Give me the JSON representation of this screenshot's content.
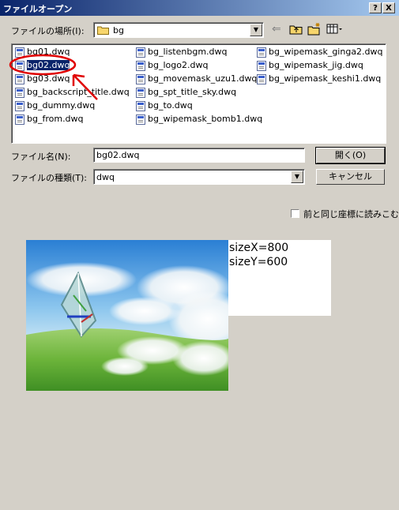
{
  "window": {
    "title": "ファイルオープン",
    "help_label": "?",
    "close_label": "X"
  },
  "location": {
    "label": "ファイルの場所(I):",
    "value": "bg"
  },
  "files": [
    "bg01.dwq",
    "bg02.dwq",
    "bg03.dwq",
    "bg_backscript_title.dwq",
    "bg_dummy.dwq",
    "bg_from.dwq",
    "bg_listenbgm.dwq",
    "bg_logo2.dwq",
    "bg_movemask_uzu1.dwq",
    "bg_spt_title_sky.dwq",
    "bg_to.dwq",
    "bg_wipemask_bomb1.dwq",
    "bg_wipemask_ginga2.dwq",
    "bg_wipemask_jig.dwq",
    "bg_wipemask_keshi1.dwq"
  ],
  "selected_file": "bg02.dwq",
  "filename": {
    "label": "ファイル名(N):",
    "value": "bg02.dwq"
  },
  "filetype": {
    "label": "ファイルの種類(T):",
    "value": "dwq"
  },
  "buttons": {
    "open": "開く(O)",
    "cancel": "キャンセル"
  },
  "checkbox": {
    "label": "前と同じ座標に読みこむ",
    "checked": false
  },
  "preview": {
    "size_x": "sizeX=800",
    "size_y": "sizeY=600"
  }
}
